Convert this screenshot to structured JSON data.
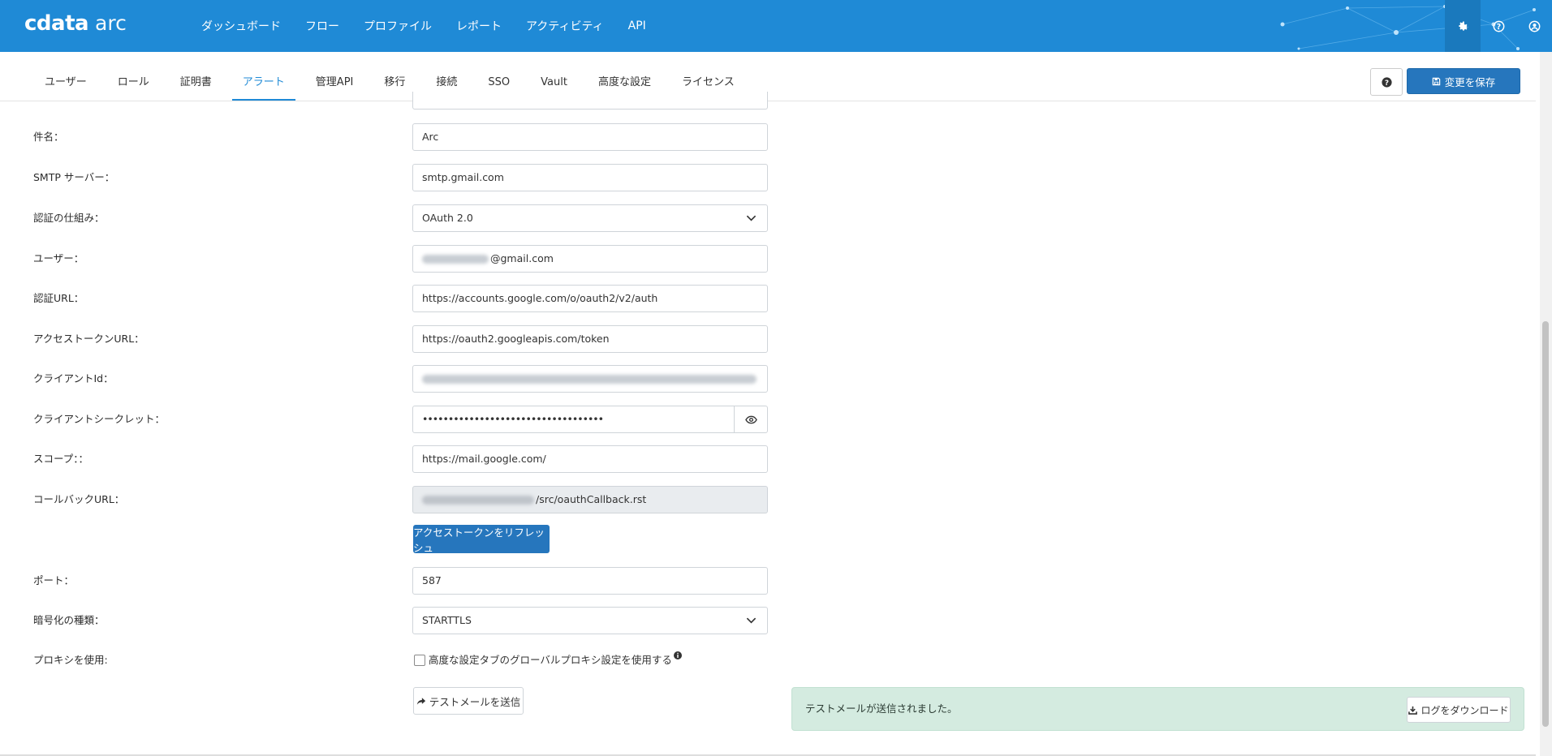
{
  "app": {
    "logo_bold": "cdata",
    "logo_light": "arc"
  },
  "top_nav": [
    "ダッシュボード",
    "フロー",
    "プロファイル",
    "レポート",
    "アクティビティ",
    "API"
  ],
  "top_icons": [
    "gear-icon",
    "question-circle-icon",
    "user-circle-icon"
  ],
  "tabs": [
    "ユーザー",
    "ロール",
    "証明書",
    "アラート",
    "管理API",
    "移行",
    "接続",
    "SSO",
    "Vault",
    "高度な設定",
    "ライセンス"
  ],
  "active_tab": "アラート",
  "save_label": "変更を保存",
  "form": {
    "subject": {
      "label": "件名：",
      "value": "Arc"
    },
    "smtp_server": {
      "label": "SMTP サーバー：",
      "value": "smtp.gmail.com"
    },
    "auth_scheme": {
      "label": "認証の仕組み：",
      "value": "OAuth 2.0"
    },
    "user": {
      "label": "ユーザー：",
      "value_suffix": "@gmail.com"
    },
    "auth_url": {
      "label": "認証URL：",
      "value": "https://accounts.google.com/o/oauth2/v2/auth"
    },
    "token_url": {
      "label": "アクセストークンURL：",
      "value": "https://oauth2.googleapis.com/token"
    },
    "client_id": {
      "label": "クライアントId："
    },
    "client_secret": {
      "label": "クライアントシークレット：",
      "value": "•••••••••••••••••••••••••••••••••••"
    },
    "scope": {
      "label": "スコープ：：",
      "value": "https://mail.google.com/"
    },
    "callback_url": {
      "label": "コールバックURL：",
      "value_suffix": "/src/oauthCallback.rst"
    },
    "refresh_button": "アクセストークンをリフレッシュ",
    "port": {
      "label": "ポート：",
      "value": "587"
    },
    "encryption": {
      "label": "暗号化の種類：",
      "value": "STARTTLS"
    },
    "proxy": {
      "label": "プロキシを使用:",
      "checkbox_label": "高度な設定タブのグローバルプロキシ設定を使用する",
      "checked": false
    },
    "test_button": "テストメールを送信"
  },
  "alert": {
    "message": "テストメールが送信されました。",
    "download_button": "ログをダウンロード"
  }
}
